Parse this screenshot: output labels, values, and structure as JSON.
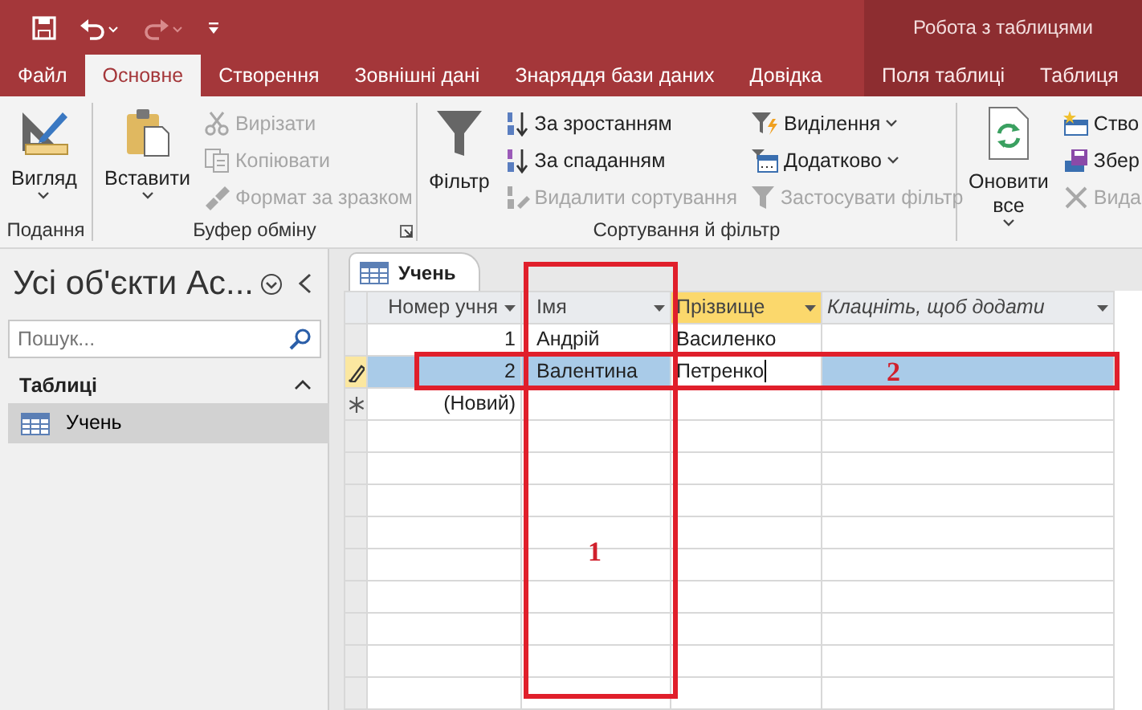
{
  "quick_access": [
    {
      "kind": "save",
      "disabled": false
    },
    {
      "kind": "undo",
      "disabled": false
    },
    {
      "kind": "redo",
      "disabled": true
    },
    {
      "kind": "customize",
      "disabled": false
    }
  ],
  "context_title": "Робота з таблицями",
  "tabs": [
    {
      "label": "Файл",
      "selected": false,
      "contextual": false
    },
    {
      "label": "Основне",
      "selected": true,
      "contextual": false
    },
    {
      "label": "Створення",
      "selected": false,
      "contextual": false
    },
    {
      "label": "Зовнішні дані",
      "selected": false,
      "contextual": false
    },
    {
      "label": "Знаряддя бази даних",
      "selected": false,
      "contextual": false
    },
    {
      "label": "Довідка",
      "selected": false,
      "contextual": false
    },
    {
      "label": "Поля таблиці",
      "selected": false,
      "contextual": true
    },
    {
      "label": "Таблиця",
      "selected": false,
      "contextual": true
    }
  ],
  "ribbon": [
    {
      "label": "Подання",
      "launcher": false,
      "columns": [
        [
          {
            "kind": "large",
            "label": "Вигляд",
            "dropdown": true,
            "disabled": false
          }
        ]
      ]
    },
    {
      "label": "Буфер обміну",
      "launcher": true,
      "columns": [
        [
          {
            "kind": "large",
            "label": "Вставити",
            "dropdown": true,
            "disabled": false
          }
        ],
        [
          {
            "kind": "small",
            "label": "Вирізати",
            "dropdown": false,
            "disabled": true
          },
          {
            "kind": "small",
            "label": "Копіювати",
            "dropdown": false,
            "disabled": true
          },
          {
            "kind": "small",
            "label": "Формат за зразком",
            "dropdown": false,
            "disabled": true
          }
        ]
      ]
    },
    {
      "label": "Сортування й фільтр",
      "launcher": false,
      "columns": [
        [
          {
            "kind": "large",
            "label": "Фільтр",
            "dropdown": false,
            "disabled": false
          }
        ],
        [
          {
            "kind": "small",
            "label": "За зростанням",
            "dropdown": false,
            "disabled": false
          },
          {
            "kind": "small",
            "label": "За спаданням",
            "dropdown": false,
            "disabled": false
          },
          {
            "kind": "small",
            "label": "Видалити сортування",
            "dropdown": false,
            "disabled": true
          }
        ],
        [
          {
            "kind": "small",
            "label": "Виділення",
            "dropdown": true,
            "disabled": false
          },
          {
            "kind": "small",
            "label": "Додатково",
            "dropdown": true,
            "disabled": false
          },
          {
            "kind": "small",
            "label": "Застосувати фільтр",
            "dropdown": false,
            "disabled": true
          }
        ]
      ]
    },
    {
      "columns": [
        [
          {
            "kind": "large",
            "label": "Оновити все",
            "dropdown": true,
            "disabled": false
          }
        ],
        [
          {
            "kind": "small",
            "label": "Ство",
            "disabled": false
          },
          {
            "kind": "small",
            "label": "Збер",
            "disabled": false
          },
          {
            "kind": "small",
            "label": "Вида",
            "disabled": true
          }
        ]
      ]
    }
  ],
  "nav": {
    "title": "Усі об'єкти Ac...",
    "search": {
      "placeholder": "Пошук..."
    },
    "section": {
      "label": "Таблиці",
      "expanded": true
    },
    "items": [
      {
        "label": "Учень",
        "selected": true
      }
    ]
  },
  "datasheet": {
    "tab": "Учень",
    "columns": [
      {
        "label": "Номер учня",
        "kind": "number",
        "selected": false
      },
      {
        "label": "Імя",
        "kind": "field",
        "selected": false
      },
      {
        "label": "Прізвище",
        "kind": "field",
        "selected": true
      },
      {
        "label": "Клацніть, щоб додати",
        "kind": "add",
        "selected": false
      }
    ],
    "rows": [
      {
        "kind": "record",
        "selected": false,
        "editing": false,
        "cells": [
          {
            "text": "1",
            "editing": false
          },
          {
            "text": "Андрій",
            "editing": false
          },
          {
            "text": "Василенко",
            "editing": false
          }
        ]
      },
      {
        "kind": "record",
        "selected": true,
        "editing": true,
        "cells": [
          {
            "text": "2",
            "editing": false
          },
          {
            "text": "Валентина",
            "editing": false
          },
          {
            "text": "Петренко",
            "editing": true
          }
        ]
      },
      {
        "kind": "new",
        "selected": false,
        "editing": false,
        "cells": [
          {
            "text": "(Новий)",
            "editing": false
          }
        ]
      }
    ]
  },
  "annotations": [
    {
      "kind": "column",
      "label": "1"
    },
    {
      "kind": "row",
      "label": "2"
    }
  ]
}
